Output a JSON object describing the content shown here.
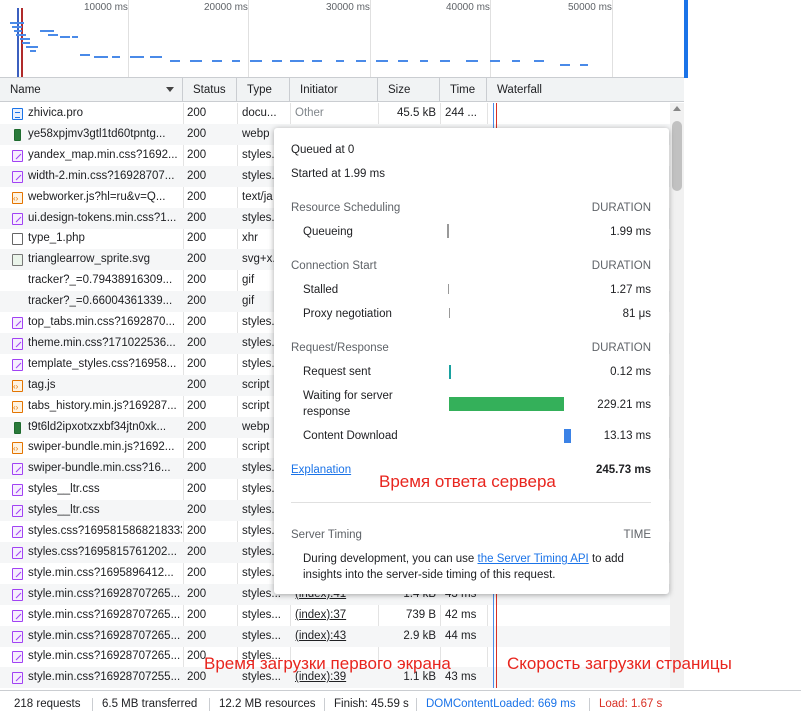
{
  "overview": {
    "ticks": [
      "10000 ms",
      "20000 ms",
      "30000 ms",
      "40000 ms",
      "50000 ms"
    ]
  },
  "columns": {
    "name": "Name",
    "status": "Status",
    "type": "Type",
    "initiator": "Initiator",
    "size": "Size",
    "time": "Time",
    "waterfall": "Waterfall"
  },
  "rows": [
    {
      "icon": "doc",
      "name": "zhivica.pro",
      "status": "200",
      "type": "docu...",
      "initiator": "Other",
      "initiator_style": "grey",
      "size": "45.5 kB",
      "time": "244 ..."
    },
    {
      "icon": "webp",
      "name": "ye58xpjmv3gtl1td60tpntg...",
      "status": "200",
      "type": "webp",
      "initiator": "",
      "initiator_style": "",
      "size": "",
      "time": ""
    },
    {
      "icon": "css",
      "name": "yandex_map.min.css?1692...",
      "status": "200",
      "type": "styles...",
      "initiator": "",
      "initiator_style": "",
      "size": "",
      "time": ""
    },
    {
      "icon": "css",
      "name": "width-2.min.css?16928707...",
      "status": "200",
      "type": "styles...",
      "initiator": "",
      "initiator_style": "",
      "size": "",
      "time": ""
    },
    {
      "icon": "js",
      "name": "webworker.js?hl=ru&v=Q...",
      "status": "200",
      "type": "text/ja",
      "initiator": "",
      "initiator_style": "",
      "size": "",
      "time": ""
    },
    {
      "icon": "css",
      "name": "ui.design-tokens.min.css?1...",
      "status": "200",
      "type": "styles...",
      "initiator": "",
      "initiator_style": "",
      "size": "",
      "time": ""
    },
    {
      "icon": "xhr",
      "name": "type_1.php",
      "status": "200",
      "type": "xhr",
      "initiator": "",
      "initiator_style": "",
      "size": "",
      "time": ""
    },
    {
      "icon": "img",
      "name": "trianglearrow_sprite.svg",
      "status": "200",
      "type": "svg+x...",
      "initiator": "",
      "initiator_style": "",
      "size": "",
      "time": ""
    },
    {
      "icon": "none",
      "name": "tracker?_=0.79438916309...",
      "status": "200",
      "type": "gif",
      "initiator": "",
      "initiator_style": "",
      "size": "",
      "time": ""
    },
    {
      "icon": "none",
      "name": "tracker?_=0.66004361339...",
      "status": "200",
      "type": "gif",
      "initiator": "",
      "initiator_style": "",
      "size": "",
      "time": ""
    },
    {
      "icon": "css",
      "name": "top_tabs.min.css?1692870...",
      "status": "200",
      "type": "styles...",
      "initiator": "",
      "initiator_style": "",
      "size": "",
      "time": ""
    },
    {
      "icon": "css",
      "name": "theme.min.css?171022536...",
      "status": "200",
      "type": "styles...",
      "initiator": "",
      "initiator_style": "",
      "size": "",
      "time": ""
    },
    {
      "icon": "css",
      "name": "template_styles.css?16958...",
      "status": "200",
      "type": "styles...",
      "initiator": "",
      "initiator_style": "",
      "size": "",
      "time": ""
    },
    {
      "icon": "js",
      "name": "tag.js",
      "status": "200",
      "type": "script",
      "initiator": "",
      "initiator_style": "",
      "size": "",
      "time": ""
    },
    {
      "icon": "js",
      "name": "tabs_history.min.js?169287...",
      "status": "200",
      "type": "script",
      "initiator": "",
      "initiator_style": "",
      "size": "",
      "time": ""
    },
    {
      "icon": "webp",
      "name": "t9t6ld2ipxotxzxbf34jtn0xk...",
      "status": "200",
      "type": "webp",
      "initiator": "",
      "initiator_style": "",
      "size": "",
      "time": ""
    },
    {
      "icon": "js",
      "name": "swiper-bundle.min.js?1692...",
      "status": "200",
      "type": "script",
      "initiator": "",
      "initiator_style": "",
      "size": "",
      "time": ""
    },
    {
      "icon": "css",
      "name": "swiper-bundle.min.css?16...",
      "status": "200",
      "type": "styles...",
      "initiator": "",
      "initiator_style": "",
      "size": "",
      "time": ""
    },
    {
      "icon": "css",
      "name": "styles__ltr.css",
      "status": "200",
      "type": "styles...",
      "initiator": "",
      "initiator_style": "",
      "size": "",
      "time": ""
    },
    {
      "icon": "css",
      "name": "styles__ltr.css",
      "status": "200",
      "type": "styles...",
      "initiator": "",
      "initiator_style": "",
      "size": "",
      "time": ""
    },
    {
      "icon": "css",
      "name": "styles.css?1695815868218333",
      "status": "200",
      "type": "styles...",
      "initiator": "",
      "initiator_style": "",
      "size": "",
      "time": ""
    },
    {
      "icon": "css",
      "name": "styles.css?1695815761202...",
      "status": "200",
      "type": "styles...",
      "initiator": "",
      "initiator_style": "",
      "size": "",
      "time": ""
    },
    {
      "icon": "css",
      "name": "style.min.css?1695896412...",
      "status": "200",
      "type": "styles...",
      "initiator": "",
      "initiator_style": "",
      "size": "",
      "time": ""
    },
    {
      "icon": "css",
      "name": "style.min.css?16928707265...",
      "status": "200",
      "type": "styles...",
      "initiator": "(index):41",
      "initiator_style": "link",
      "size": "1.4 kB",
      "time": "43 ms"
    },
    {
      "icon": "css",
      "name": "style.min.css?16928707265...",
      "status": "200",
      "type": "styles...",
      "initiator": "(index):37",
      "initiator_style": "link",
      "size": "739 B",
      "time": "42 ms"
    },
    {
      "icon": "css",
      "name": "style.min.css?16928707265...",
      "status": "200",
      "type": "styles...",
      "initiator": "(index):43",
      "initiator_style": "link",
      "size": "2.9 kB",
      "time": "44 ms"
    },
    {
      "icon": "css",
      "name": "style.min.css?16928707265...",
      "status": "200",
      "type": "styles...",
      "initiator": "",
      "initiator_style": "",
      "size": "",
      "time": ""
    },
    {
      "icon": "css",
      "name": "style.min.css?16928707255...",
      "status": "200",
      "type": "styles...",
      "initiator": "(index):39",
      "initiator_style": "link",
      "size": "1.1 kB",
      "time": "43 ms"
    }
  ],
  "timing": {
    "queued": "Queued at 0",
    "started": "Started at 1.99 ms",
    "duration_label": "DURATION",
    "resource_scheduling": "Resource Scheduling",
    "queueing_label": "Queueing",
    "queueing_value": "1.99 ms",
    "connection_start": "Connection Start",
    "stalled_label": "Stalled",
    "stalled_value": "1.27 ms",
    "proxy_label": "Proxy negotiation",
    "proxy_value": "81 μs",
    "request_response": "Request/Response",
    "request_sent_label": "Request sent",
    "request_sent_value": "0.12 ms",
    "waiting_label_1": "Waiting for server",
    "waiting_label_2": "response",
    "waiting_value": "229.21 ms",
    "download_label": "Content Download",
    "download_value": "13.13 ms",
    "explanation": "Explanation",
    "total": "245.73 ms",
    "server_timing": "Server Timing",
    "time_label": "TIME",
    "dev_text_1": "During development, you can use ",
    "dev_link": "the Server Timing API",
    "dev_text_2": " to add",
    "dev_text_3": "insights into the server-side timing of this request.",
    "waiting_color": "#34b05a",
    "download_color": "#3b82e6"
  },
  "annotations": {
    "server_response": "Время ответа сервера",
    "first_screen": "Время загрузки первого экрана",
    "page_load_speed": "Скорость загрузки страницы",
    "color": "#e8251e"
  },
  "statusbar": {
    "requests": "218 requests",
    "transferred": "6.5 MB transferred",
    "resources": "12.2 MB resources",
    "finish": "Finish: 45.59 s",
    "dom_content_loaded": "DOMContentLoaded: 669 ms",
    "load": "Load: 1.67 s",
    "dcl_color": "#1a73e8",
    "load_color": "#d93025"
  }
}
